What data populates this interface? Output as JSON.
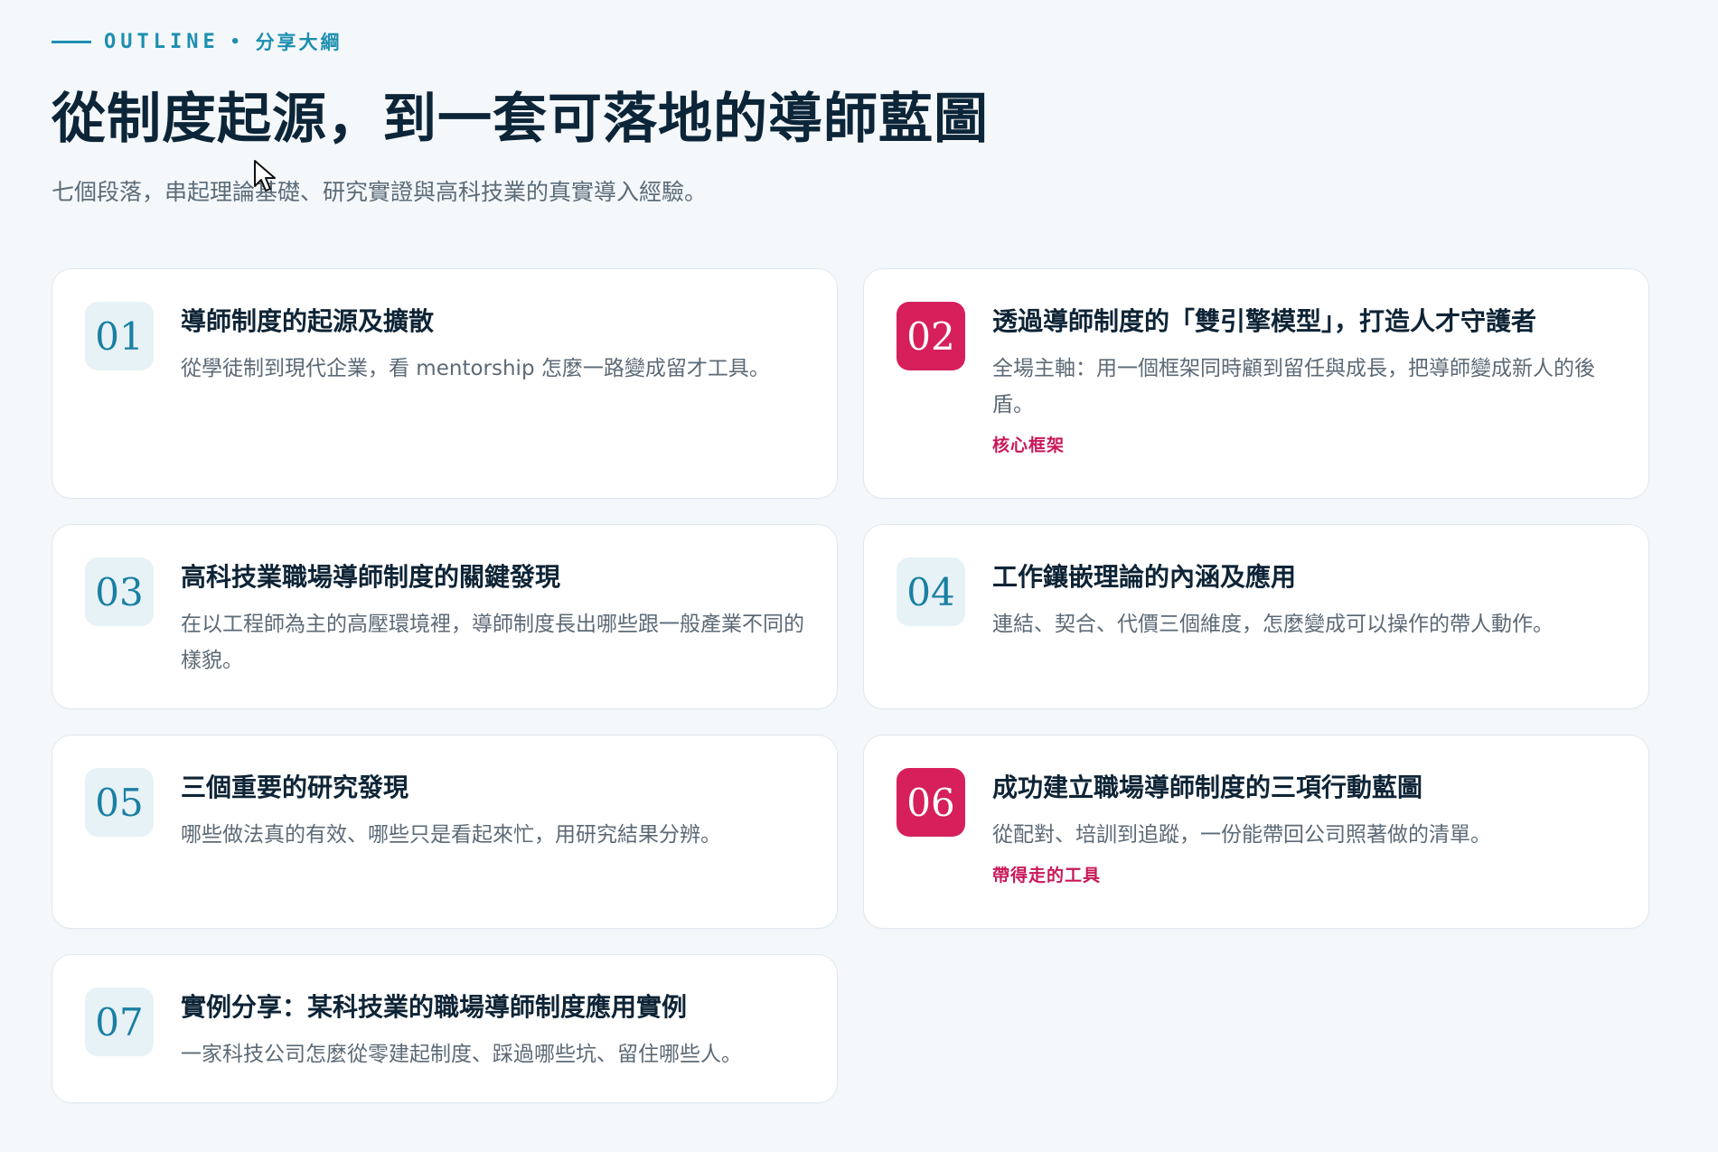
{
  "header": {
    "eyebrow_en": "OUTLINE",
    "eyebrow_dot": "•",
    "eyebrow_zh": "分享大綱",
    "title": "從制度起源，到一套可落地的導師藍圖",
    "subtitle": "七個段落，串起理論基礎、研究實證與高科技業的真實導入經驗。"
  },
  "sections": [
    {
      "number": "01",
      "title": "導師制度的起源及擴散",
      "desc": "從學徒制到現代企業，看 mentorship 怎麼一路變成留才工具。",
      "tag": ""
    },
    {
      "number": "02",
      "title": "透過導師制度的「雙引擎模型」，打造人才守護者",
      "desc": "全場主軸：用一個框架同時顧到留任與成長，把導師變成新人的後盾。",
      "tag": "核心框架"
    },
    {
      "number": "03",
      "title": "高科技業職場導師制度的關鍵發現",
      "desc": "在以工程師為主的高壓環境裡，導師制度長出哪些跟一般產業不同的樣貌。",
      "tag": ""
    },
    {
      "number": "04",
      "title": "工作鑲嵌理論的內涵及應用",
      "desc": "連結、契合、代價三個維度，怎麼變成可以操作的帶人動作。",
      "tag": ""
    },
    {
      "number": "05",
      "title": "三個重要的研究發現",
      "desc": "哪些做法真的有效、哪些只是看起來忙，用研究結果分辨。",
      "tag": ""
    },
    {
      "number": "06",
      "title": "成功建立職場導師制度的三項行動藍圖",
      "desc": "從配對、培訓到追蹤，一份能帶回公司照著做的清單。",
      "tag": "帶得走的工具"
    },
    {
      "number": "07",
      "title": "實例分享：某科技業的職場導師制度應用實例",
      "desc": "一家科技公司怎麼從零建起制度、踩過哪些坑、留住哪些人。",
      "tag": ""
    }
  ],
  "colors": {
    "accent": "#d61f5b",
    "primary": "#1d8fb0",
    "background": "#f5f8fb"
  }
}
